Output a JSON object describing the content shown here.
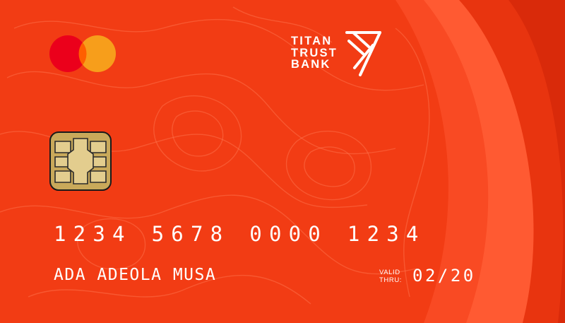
{
  "card": {
    "network_icon": "mastercard-logo",
    "bank_name_line1": "TITAN",
    "bank_name_line2": "TRUST",
    "bank_name_line3": "BANK",
    "bank_icon": "titan-trust-bank-logo",
    "chip_icon": "emv-chip",
    "number_groups": [
      "1234",
      "5678",
      "0000",
      "1234"
    ],
    "holder_name": "ADA ADEOLA MUSA",
    "valid_label_line1": "VALID",
    "valid_label_line2": "THRU:",
    "expiry": "02/20",
    "colors": {
      "background": "#f23c14",
      "wave_light": "#ff5a32",
      "wave_dark": "#e02e0c",
      "mastercard_red": "#eb001b",
      "mastercard_orange": "#f79e1b",
      "chip_gold": "#d2b466"
    }
  }
}
